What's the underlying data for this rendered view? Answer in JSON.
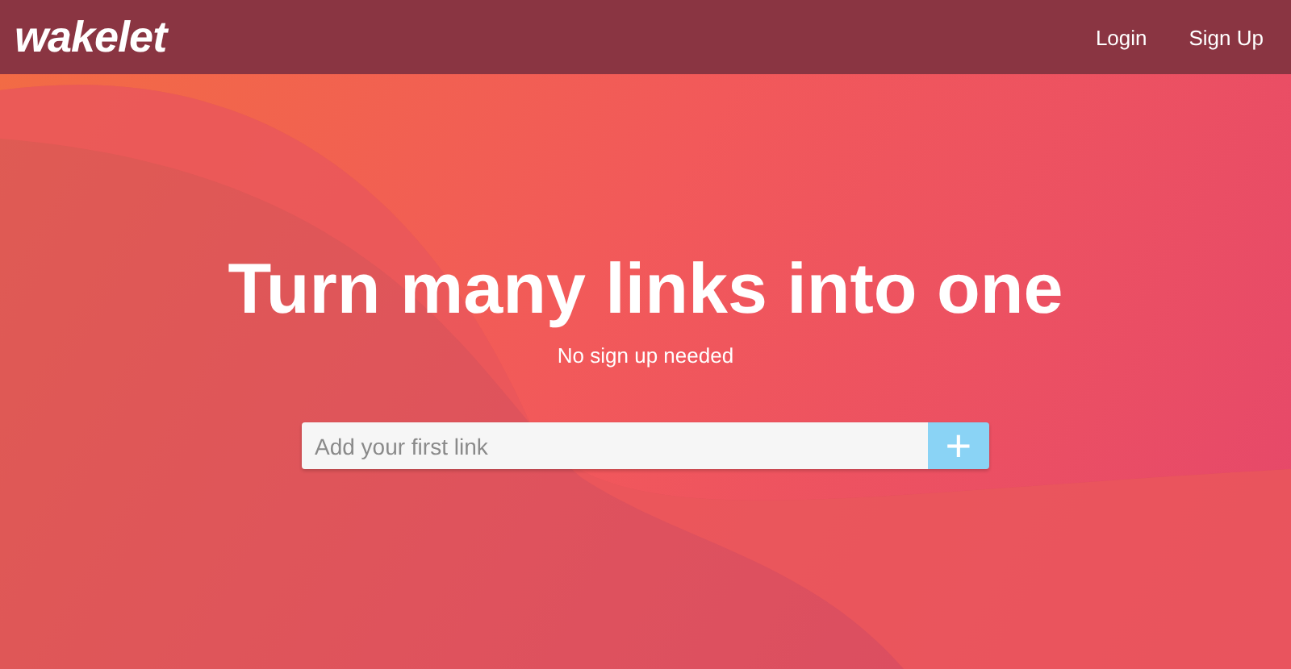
{
  "header": {
    "logo": "wakelet",
    "links": [
      {
        "label": "Login"
      },
      {
        "label": "Sign Up"
      }
    ]
  },
  "hero": {
    "title": "Turn many links into one",
    "subtitle": "No sign up needed",
    "link_field": {
      "placeholder": "Add your first link"
    },
    "add_button": {
      "label": "+"
    }
  }
}
